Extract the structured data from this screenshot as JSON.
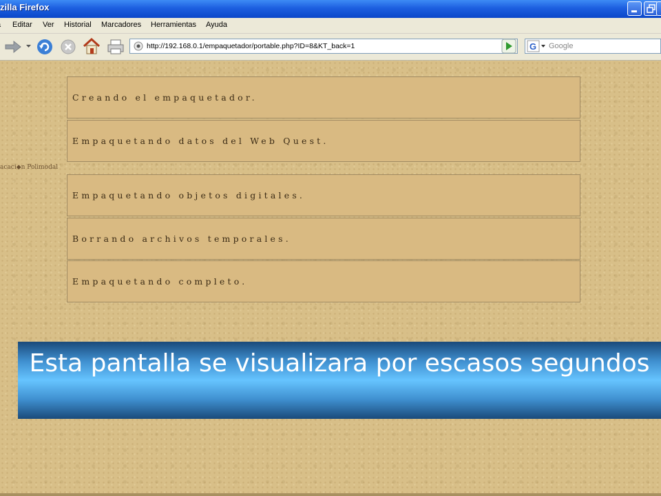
{
  "window": {
    "title": "zilla Firefox"
  },
  "menu": {
    "items": [
      {
        "label": "a"
      },
      {
        "label": "Editar"
      },
      {
        "label": "Ver"
      },
      {
        "label": "Historial"
      },
      {
        "label": "Marcadores"
      },
      {
        "label": "Herramientas"
      },
      {
        "label": "Ayuda"
      }
    ]
  },
  "navigation": {
    "url": "http://192.168.0.1/empaquetador/portable.php?ID=8&KT_back=1",
    "search_engine": "Google",
    "search_placeholder": "Google"
  },
  "page": {
    "side_text": "acaci◆n Polimodal",
    "steps": [
      {
        "text": "Creando el empaquetador."
      },
      {
        "text": "Empaquetando datos del Web Quest."
      },
      {
        "text": "Empaquetando objetos digitales."
      },
      {
        "text": "Borrando archivos temporales."
      },
      {
        "text": "Empaquetando completo."
      }
    ]
  },
  "caption": {
    "text": "Esta pantalla se visualizara por escasos segundos"
  },
  "colors": {
    "titlebar": "#0a46c9",
    "background": "#d8bf88",
    "step_box": "#d9ba82",
    "banner_center": "#66c4ff"
  }
}
